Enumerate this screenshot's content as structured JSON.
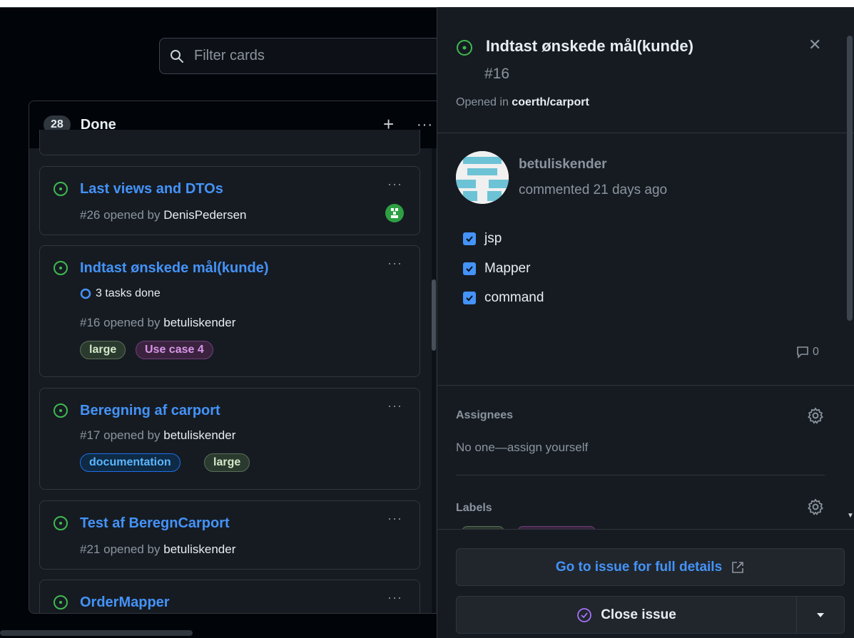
{
  "search": {
    "placeholder": "Filter cards"
  },
  "column": {
    "count": "28",
    "title": "Done",
    "add_icon": "plus-icon",
    "menu_icon": "kebab-horizontal-icon"
  },
  "cards": [
    {
      "title": "Last views and DTOs",
      "number": "#26",
      "opened_by_text": "opened by",
      "author": "DenisPedersen"
    },
    {
      "title": "Indtast ønskede mål(kunde)",
      "tasks": "3 tasks done",
      "number": "#16",
      "opened_by_text": "opened by",
      "author": "betuliskender",
      "labels": [
        "large",
        "Use case 4"
      ]
    },
    {
      "title": "Beregning af carport",
      "number": "#17",
      "opened_by_text": "opened by",
      "author": "betuliskender",
      "labels": [
        "documentation",
        "large"
      ]
    },
    {
      "title": "Test af BeregnCarport",
      "number": "#21",
      "opened_by_text": "opened by",
      "author": "betuliskender"
    },
    {
      "title": "OrderMapper"
    }
  ],
  "panel": {
    "title": "Indtast ønskede mål(kunde)",
    "number": "#16",
    "opened_in_text": "Opened in",
    "repo": "coerth/carport",
    "comment": {
      "user": "betuliskender",
      "time": "commented 21 days ago"
    },
    "tasks": [
      "jsp",
      "Mapper",
      "command"
    ],
    "comment_count": "0",
    "assignees_label": "Assignees",
    "assignees_value": "No one—assign yourself",
    "labels_label": "Labels",
    "goto_button": "Go to issue for full details",
    "close_button": "Close issue"
  },
  "colors": {
    "accent": "#4493f8",
    "open_green": "#3fb950",
    "close_purple": "#a371f7"
  }
}
